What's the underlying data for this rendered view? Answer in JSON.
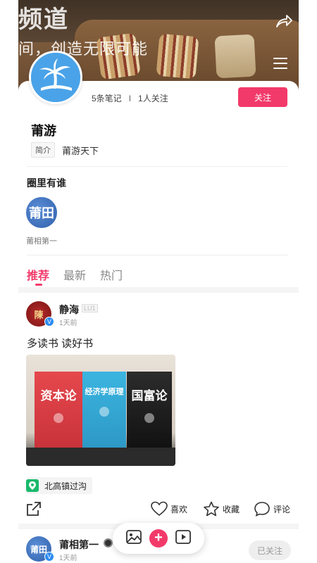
{
  "banner": {
    "title": "频道",
    "subtitle": "间，创造无限可能"
  },
  "profile": {
    "notes_count": "5条笔记",
    "separator": "I",
    "follow_count": "1人关注",
    "follow_label": "关注",
    "name": "莆游",
    "intro_tag": "简介",
    "intro_text": "莆游天下"
  },
  "circle": {
    "title": "圈里有谁",
    "members": [
      {
        "name": "莆相第一",
        "avatar_text": "莆田"
      }
    ]
  },
  "tabs": [
    {
      "label": "推荐",
      "active": true
    },
    {
      "label": "最新",
      "active": false
    },
    {
      "label": "热门",
      "active": false
    }
  ],
  "post": {
    "author": "静海",
    "level": "LU1",
    "time": "1天前",
    "avatar_text": "陳",
    "text": "多读书 读好书",
    "books": [
      "资本论",
      "经济学原理",
      "国富论"
    ],
    "location": "北高镇过沟",
    "like_label": "喜欢",
    "fav_label": "收藏",
    "comment_label": "评论"
  },
  "post2": {
    "author": "莆相第一",
    "time": "1天前",
    "avatar_text": "莆田",
    "follow_label": "已关注"
  },
  "colors": {
    "accent": "#f23a6a",
    "verified": "#2d8cf0",
    "location_pin": "#19b96b"
  }
}
